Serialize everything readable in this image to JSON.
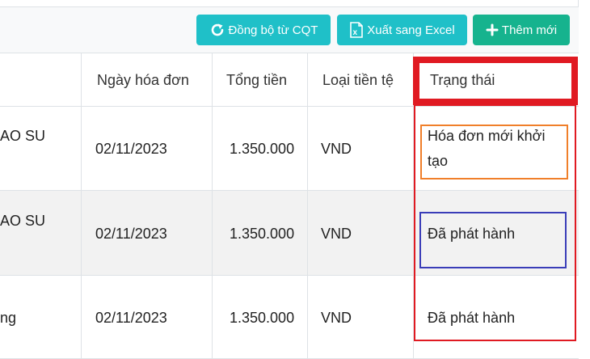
{
  "toolbar": {
    "sync_label": "Đồng bộ từ CQT",
    "excel_label": "Xuất sang Excel",
    "add_label": "Thêm mới"
  },
  "table": {
    "headers": {
      "date": "Ngày hóa đơn",
      "total": "Tổng tiền",
      "currency": "Loại tiền tệ",
      "status": "Trạng thái"
    },
    "rows": [
      {
        "name_fragment": "AO SU",
        "date": "02/11/2023",
        "total": "1.350.000",
        "currency": "VND",
        "status_line1": "Hóa đơn mới khởi",
        "status_line2": "tạo"
      },
      {
        "name_fragment": "AO SU",
        "date": "02/11/2023",
        "total": "1.350.000",
        "currency": "VND",
        "status_line1": "Đã phát hành"
      },
      {
        "name_fragment": "ng",
        "date": "02/11/2023",
        "total": "1.350.000",
        "currency": "VND",
        "status_line1": "Đã phát hành"
      }
    ]
  },
  "colors": {
    "teal_button": "#1fc0c8",
    "green_button": "#16b38e",
    "highlight_red": "#e01a22",
    "highlight_orange": "#f07f2a",
    "highlight_blue": "#3a3db8"
  },
  "icons": {
    "sync": "refresh-icon",
    "excel": "excel-file-icon",
    "add": "plus-icon"
  }
}
